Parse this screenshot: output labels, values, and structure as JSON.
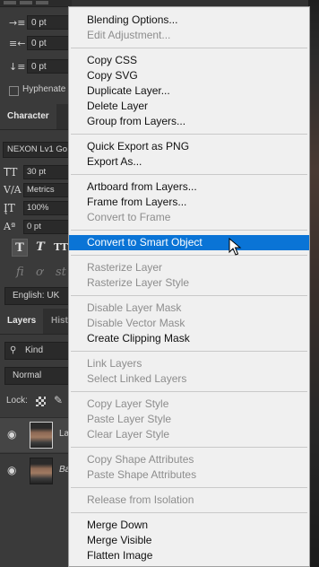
{
  "paragraph_panel": {
    "indent_left": "0 pt",
    "indent_right": "0 pt",
    "space_after": "0 pt",
    "hyphenate_label": "Hyphenate"
  },
  "character_panel": {
    "tab_label": "Character",
    "font_family": "NEXON Lv1 Go",
    "font_size": "30 pt",
    "kerning": "Metrics",
    "vertical_scale": "100%",
    "baseline_shift": "0 pt",
    "language": "English: UK"
  },
  "layers_panel": {
    "tab_label": "Layers",
    "tab2_label": "Hist",
    "filter_kind": "Kind",
    "blend_mode": "Normal",
    "lock_label": "Lock:",
    "layers": [
      {
        "name": "La",
        "selected": true
      },
      {
        "name": "Ba",
        "selected": false
      }
    ]
  },
  "context_menu": {
    "items": [
      {
        "label": "Blending Options...",
        "enabled": true
      },
      {
        "label": "Edit Adjustment...",
        "enabled": false
      },
      {
        "label": "Copy CSS",
        "enabled": true
      },
      {
        "label": "Copy SVG",
        "enabled": true
      },
      {
        "label": "Duplicate Layer...",
        "enabled": true
      },
      {
        "label": "Delete Layer",
        "enabled": true
      },
      {
        "label": "Group from Layers...",
        "enabled": true
      },
      {
        "label": "Quick Export as PNG",
        "enabled": true
      },
      {
        "label": "Export As...",
        "enabled": true
      },
      {
        "label": "Artboard from Layers...",
        "enabled": true
      },
      {
        "label": "Frame from Layers...",
        "enabled": true
      },
      {
        "label": "Convert to Frame",
        "enabled": false
      },
      {
        "label": "Convert to Smart Object",
        "enabled": true,
        "highlighted": true
      },
      {
        "label": "Rasterize Layer",
        "enabled": false
      },
      {
        "label": "Rasterize Layer Style",
        "enabled": false
      },
      {
        "label": "Disable Layer Mask",
        "enabled": false
      },
      {
        "label": "Disable Vector Mask",
        "enabled": false
      },
      {
        "label": "Create Clipping Mask",
        "enabled": true
      },
      {
        "label": "Link Layers",
        "enabled": false
      },
      {
        "label": "Select Linked Layers",
        "enabled": false
      },
      {
        "label": "Copy Layer Style",
        "enabled": false
      },
      {
        "label": "Paste Layer Style",
        "enabled": false
      },
      {
        "label": "Clear Layer Style",
        "enabled": false
      },
      {
        "label": "Copy Shape Attributes",
        "enabled": false
      },
      {
        "label": "Paste Shape Attributes",
        "enabled": false
      },
      {
        "label": "Release from Isolation",
        "enabled": false
      },
      {
        "label": "Merge Down",
        "enabled": true
      },
      {
        "label": "Merge Visible",
        "enabled": true
      },
      {
        "label": "Flatten Image",
        "enabled": true
      }
    ]
  },
  "colors": {
    "highlight": "#0a74d6",
    "menu_bg": "#f0f0f0",
    "panel_bg": "#3a3a3a"
  }
}
